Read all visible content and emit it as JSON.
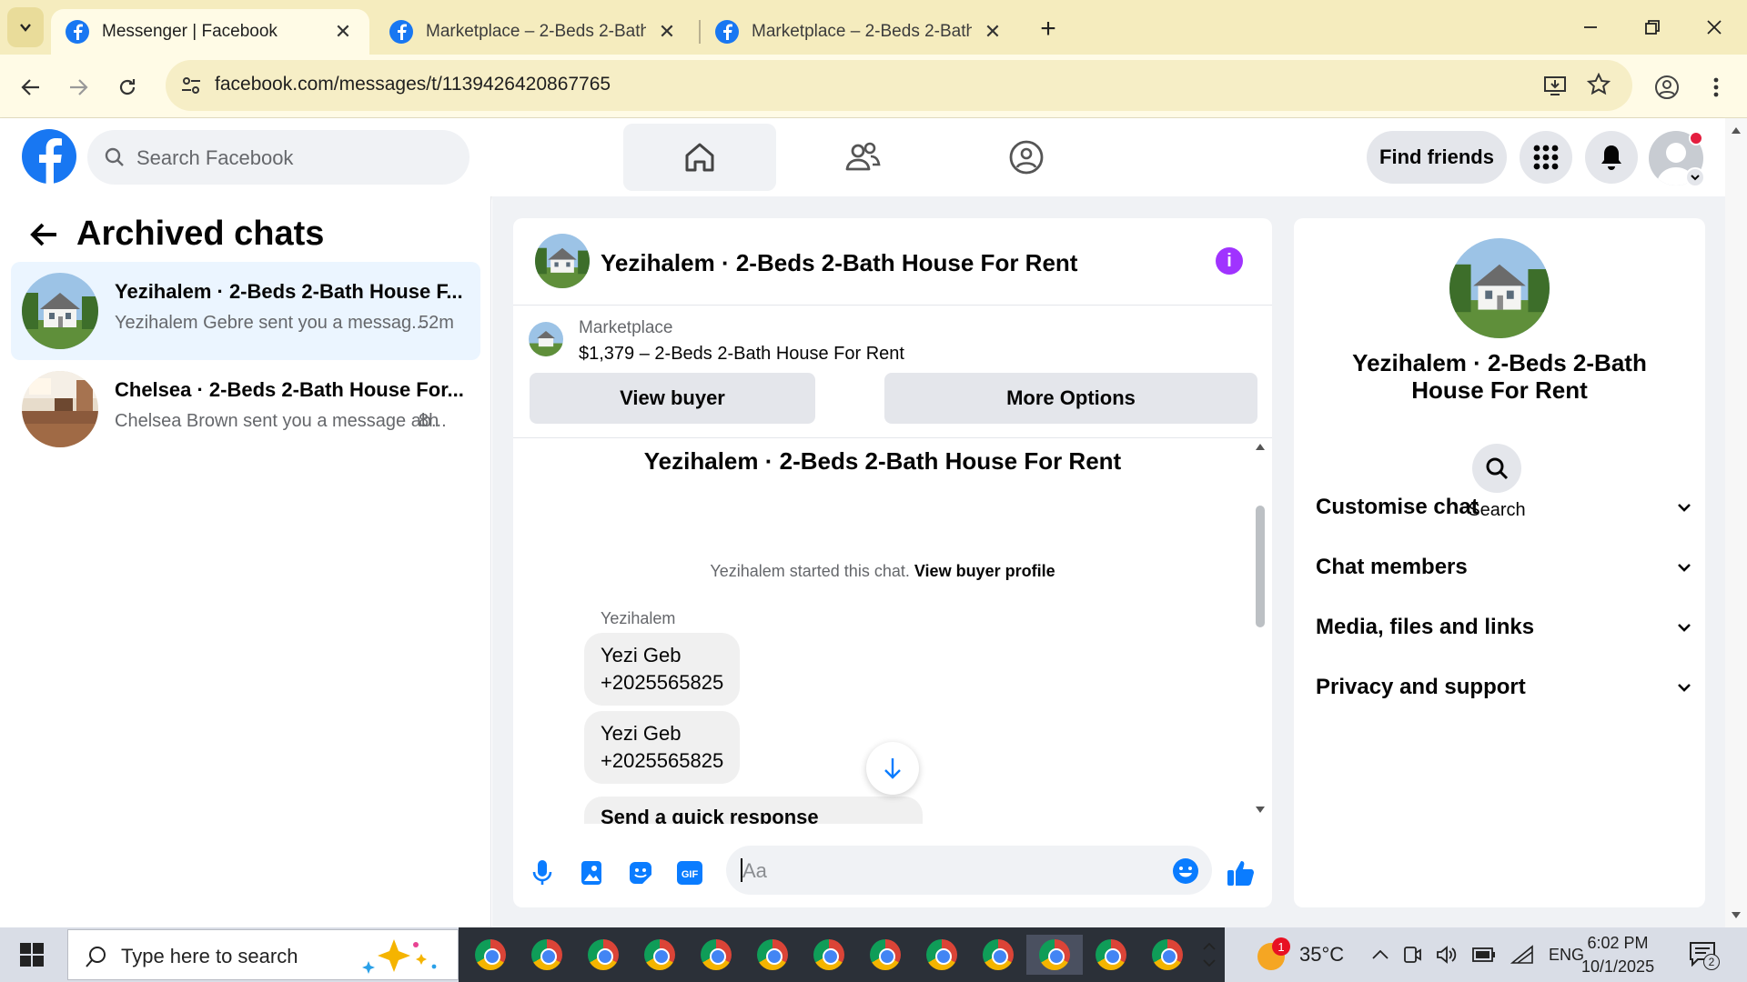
{
  "browser": {
    "tabs": [
      {
        "title": "Messenger | Facebook",
        "active": true
      },
      {
        "title": "Marketplace – 2-Beds 2-Bath H",
        "active": false
      },
      {
        "title": "Marketplace – 2-Beds 2-Bath H",
        "active": false
      }
    ],
    "url": "facebook.com/messages/t/1139426420867765"
  },
  "fb_header": {
    "search_placeholder": "Search Facebook",
    "find_friends": "Find friends"
  },
  "archived": {
    "title": "Archived chats",
    "chats": [
      {
        "name": "Yezihalem · 2-Beds 2-Bath House F...",
        "preview": "Yezihalem Gebre sent you a messag...",
        "time": "52m",
        "active": true
      },
      {
        "name": "Chelsea · 2-Beds 2-Bath House For...",
        "preview": "Chelsea Brown sent you a message ab...",
        "time": "8h",
        "active": false
      }
    ]
  },
  "chat": {
    "title": "Yezihalem · 2-Beds 2-Bath House For Rent",
    "marketplace_label": "Marketplace",
    "listing": "$1,379 – 2-Beds 2-Bath House For Rent",
    "view_buyer": "View buyer",
    "more_options": "More Options",
    "conversation_title": "Yezihalem · 2-Beds 2-Bath House For Rent",
    "started_text": "Yezihalem started this chat.",
    "view_buyer_profile": "View buyer profile",
    "sender": "Yezihalem",
    "messages": [
      {
        "line1": "Yezi Geb",
        "line2": "+2025565825"
      },
      {
        "line1": "Yezi Geb",
        "line2": "+2025565825"
      }
    ],
    "quick_response": "Send a quick response",
    "input_placeholder": "Aa"
  },
  "info": {
    "name": "Yezihalem · 2-Beds 2-Bath House For Rent",
    "search_label": "Search",
    "sections": [
      "Customise chat",
      "Chat members",
      "Media, files and links",
      "Privacy and support"
    ]
  },
  "taskbar": {
    "search_placeholder": "Type here to search",
    "weather": "35°C",
    "weather_badge": "1",
    "language": "ENG",
    "time": "6:02 PM",
    "date": "10/1/2025",
    "notifications": "2"
  },
  "colors": {
    "fb_blue": "#1877f2",
    "active_chat_bg": "#ebf5ff",
    "info_purple": "#a033ff",
    "tabbar_bg": "#f5ecbe"
  }
}
